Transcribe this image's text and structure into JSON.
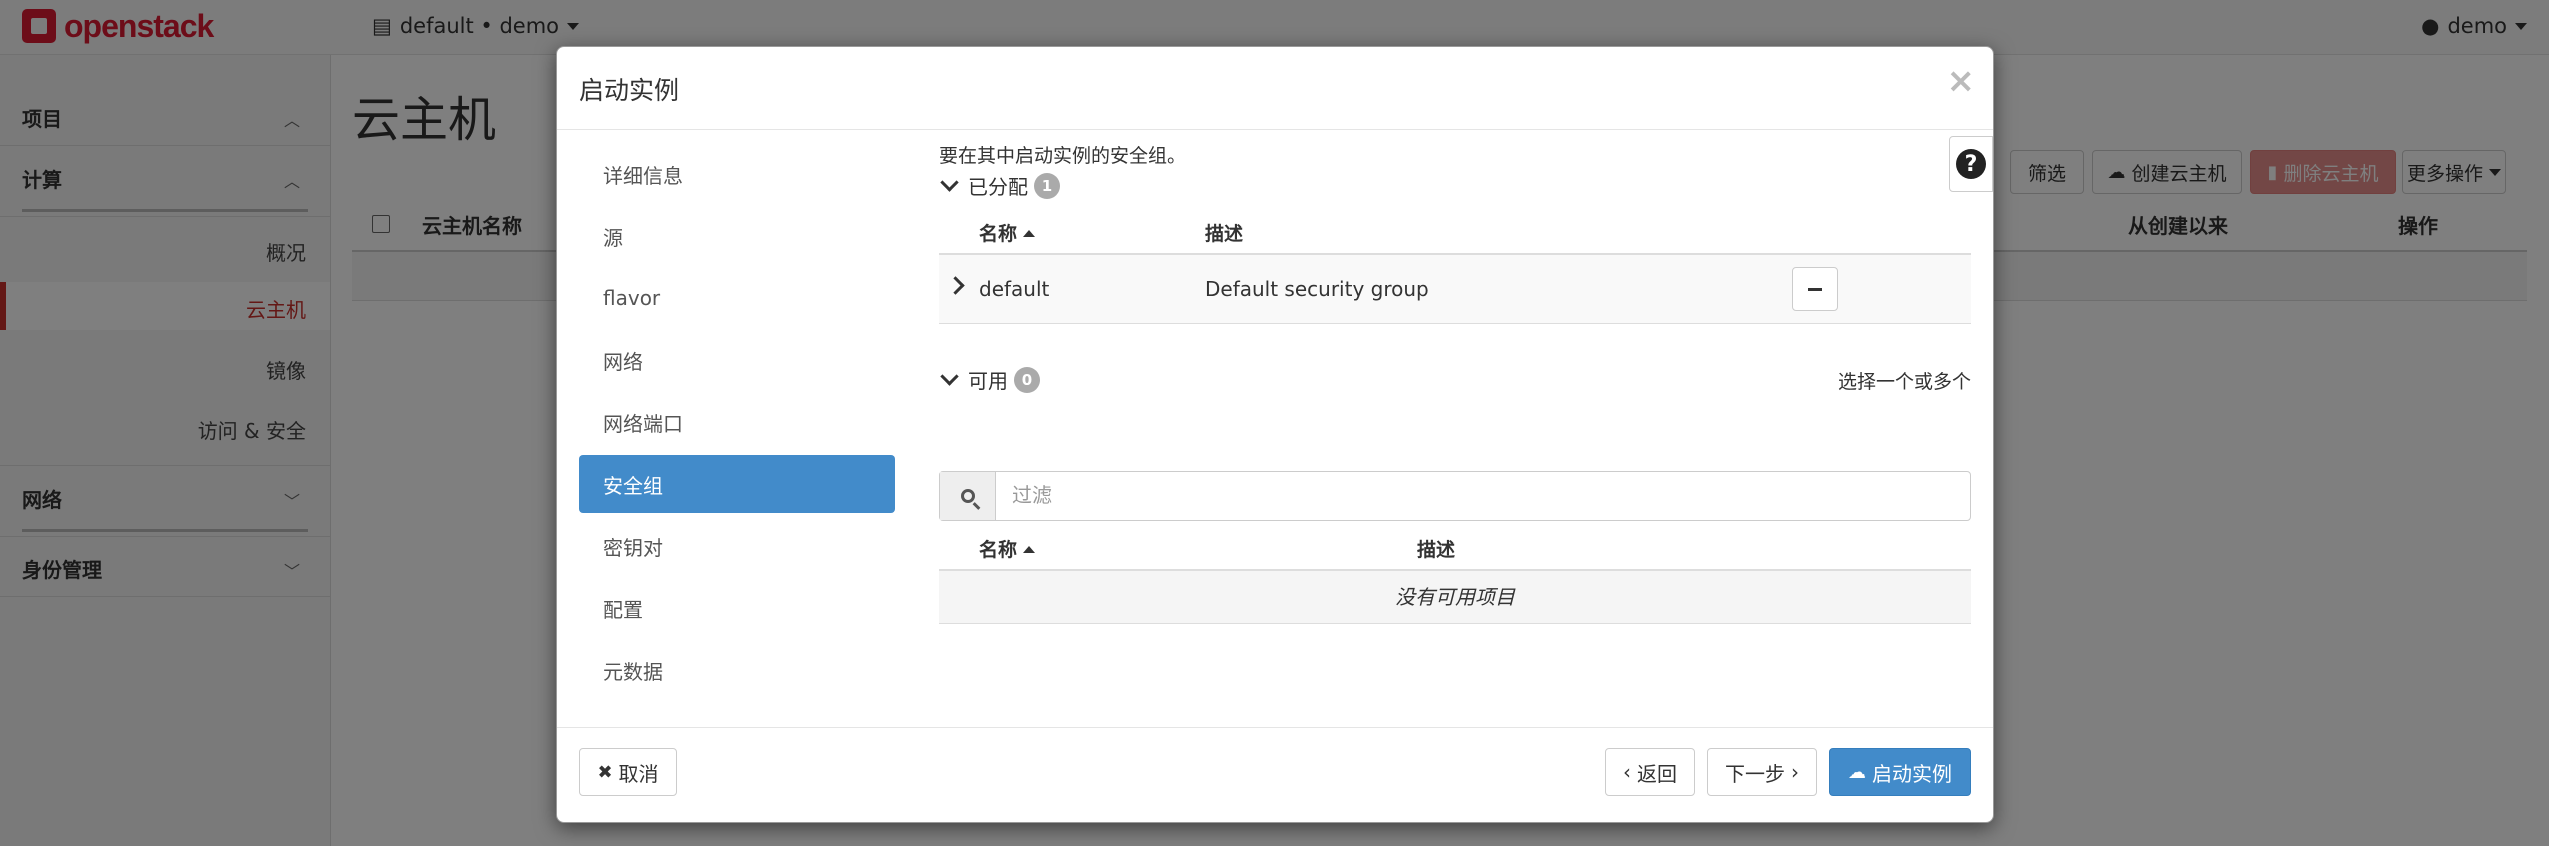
{
  "app": {
    "logo_text": "openstack",
    "project_switcher": "default • demo",
    "user": "demo"
  },
  "sidebar": {
    "sections": [
      {
        "label": "项目"
      },
      {
        "label": "计算"
      },
      {
        "label": "网络"
      },
      {
        "label": "身份管理"
      }
    ],
    "compute_items": [
      "概况",
      "云主机",
      "镜像",
      "访问 & 安全"
    ],
    "active_item": "云主机"
  },
  "page": {
    "title": "云主机",
    "toolbar": {
      "filter": "筛选",
      "create": "创建云主机",
      "delete": "删除云主机",
      "more": "更多操作"
    },
    "table_headers": {
      "name": "云主机名称",
      "since_created": "从创建以来",
      "actions": "操作"
    }
  },
  "modal": {
    "title": "启动实例",
    "close": "×",
    "steps": [
      "详细信息",
      "源",
      "flavor",
      "网络",
      "网络端口",
      "安全组",
      "密钥对",
      "配置",
      "元数据"
    ],
    "active_step": "安全组",
    "help": "?",
    "intro": "要在其中启动实例的安全组。",
    "allocated": {
      "label": "已分配",
      "count": "1",
      "headers": {
        "name": "名称",
        "description": "描述"
      },
      "rows": [
        {
          "name": "default",
          "description": "Default security group"
        }
      ]
    },
    "available": {
      "label": "可用",
      "count": "0",
      "select_hint": "选择一个或多个",
      "filter_placeholder": "过滤",
      "headers": {
        "name": "名称",
        "description": "描述"
      },
      "empty_text": "没有可用项目"
    },
    "footer": {
      "cancel": "取消",
      "back": "返回",
      "next": "下一步",
      "launch": "启动实例"
    }
  },
  "colors": {
    "primary": "#428bca",
    "brand_red": "#da1a32",
    "danger": "#d9534f",
    "active_sidebar": "#c9302c"
  }
}
